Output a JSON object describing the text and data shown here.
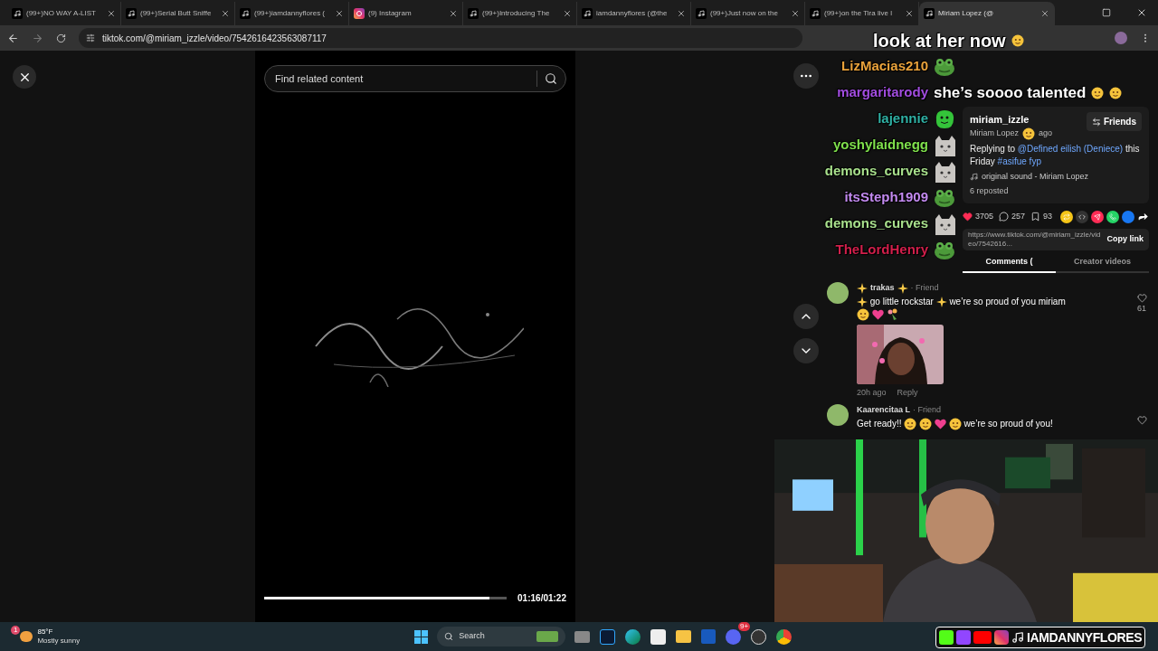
{
  "browser": {
    "tabs": [
      {
        "kind": "tiktok",
        "title": "(99+)NO WAY A-LIST",
        "selected": false
      },
      {
        "kind": "tiktok",
        "title": "(99+)Serial Butt Sniffe",
        "selected": false
      },
      {
        "kind": "tiktok",
        "title": "(99+)iamdannyflores (",
        "selected": false
      },
      {
        "kind": "instagram",
        "title": "(9) Instagram",
        "selected": false
      },
      {
        "kind": "tiktok",
        "title": "(99+)Introducing The",
        "selected": false
      },
      {
        "kind": "tiktok",
        "title": "iamdannyflores (@the",
        "selected": false
      },
      {
        "kind": "tiktok",
        "title": "(99+)Just now on the",
        "selected": false
      },
      {
        "kind": "tiktok",
        "title": "(99+)on the Tira live l",
        "selected": false
      },
      {
        "kind": "tiktok",
        "title": "Miriam Lopez (@",
        "selected": true
      }
    ],
    "address": "tiktok.com/@miriam_izzle/video/7542616423563087117"
  },
  "stream_chat": {
    "caption": "look at her now",
    "messages": [
      {
        "user": "LizMacias210",
        "color": "#e9a23b",
        "kind": "frog"
      },
      {
        "user": "margaritarody",
        "color": "#a24de0",
        "text": "she’s soooo talented"
      },
      {
        "user": "lajennie",
        "color": "#2fb0a4",
        "kind": "blob"
      },
      {
        "user": "yoshylaidnegg",
        "color": "#7fe04c",
        "kind": "cat"
      },
      {
        "user": "demons_curves",
        "color": "#a8e08c",
        "kind": "cat"
      },
      {
        "user": "itsSteph1909",
        "color": "#c38af0",
        "kind": "frog"
      },
      {
        "user": "demons_curves",
        "color": "#a8e08c",
        "kind": "cat"
      },
      {
        "user": "TheLordHenry",
        "color": "#d21f4b",
        "kind": "frog"
      }
    ]
  },
  "video": {
    "search_placeholder": "Find related content",
    "time": "01:16/01:22",
    "level": 0.93
  },
  "post": {
    "username": "miriam_izzle",
    "display_name": "Miriam Lopez",
    "time": "ago",
    "follow_button": "Friends",
    "caption": [
      {
        "kind": "text",
        "text": "Replying to"
      },
      {
        "kind": "mention",
        "text": "@Defined eilish (Deniece)"
      },
      {
        "kind": "text",
        "text": "this Friday"
      },
      {
        "kind": "hashtag",
        "text": "#asifue"
      },
      {
        "kind": "hashtag",
        "text": "fyp"
      }
    ],
    "sound": "original sound - Miriam Lopez",
    "reposted": "6 reposted",
    "likes": "3705",
    "comments": "257",
    "saves": "93",
    "link": "https://www.tiktok.com/@miriam_izzle/video/7542616...",
    "copy_button": "Copy link",
    "tabs": [
      {
        "label": "Comments (",
        "selected": true
      },
      {
        "label": "Creator videos",
        "selected": false
      }
    ]
  },
  "comments": [
    {
      "name": "trakas",
      "name_sparkles": true,
      "relation": "· Friend",
      "parts": [
        {
          "kind": "sparkle"
        },
        {
          "kind": "text",
          "text": "go little rockstar"
        },
        {
          "kind": "sparkle"
        },
        {
          "kind": "text",
          "text": "we’re so proud of you miriam"
        },
        {
          "kind": "emoji"
        },
        {
          "kind": "heart"
        },
        {
          "kind": "bouquet"
        }
      ],
      "likes": "61",
      "gif": true,
      "time": "20h ago",
      "reply": "Reply"
    },
    {
      "name": "Kaarencitaa L",
      "name_sparkles": false,
      "relation": "· Friend",
      "parts": [
        {
          "kind": "text",
          "text": "Get ready!!"
        },
        {
          "kind": "emoji"
        },
        {
          "kind": "emoji"
        },
        {
          "kind": "heart"
        },
        {
          "kind": "emoji"
        },
        {
          "kind": "text",
          "text": "we’re so proud of you!"
        }
      ]
    }
  ],
  "taskbar": {
    "temperature": "85°F",
    "weather": "Mostly sunny",
    "weather_badge": "1",
    "search": "Search",
    "discord_badge": "9+"
  },
  "overlay_banner": "IAMDANNYFLORES"
}
